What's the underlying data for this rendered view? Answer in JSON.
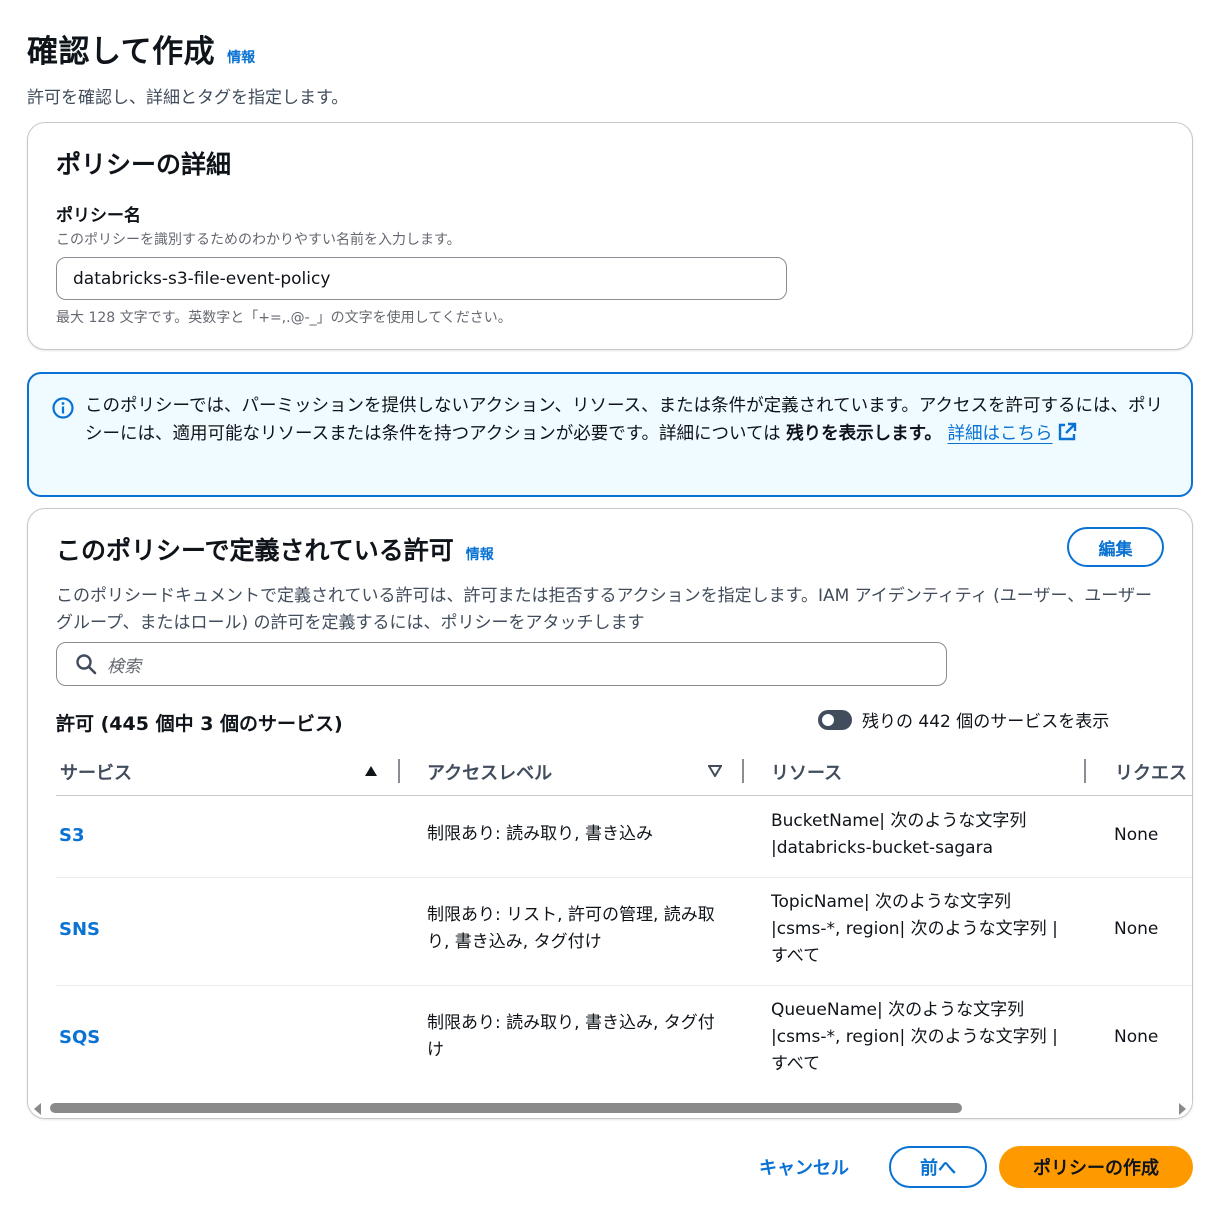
{
  "header": {
    "title": "確認して作成",
    "info_label": "情報",
    "description": "許可を確認し、詳細とタグを指定します。"
  },
  "policy_details": {
    "title": "ポリシーの詳細",
    "name_label": "ポリシー名",
    "name_description": "このポリシーを識別するためのわかりやすい名前を入力します。",
    "name_value": "databricks-s3-file-event-policy",
    "name_constraint": "最大 128 文字です。英数字と「+=,.@-_」の文字を使用してください。"
  },
  "alert": {
    "text_part1": "このポリシーでは、パーミッションを提供しないアクション、リソース、または条件が定義されています。アクセスを許可するには、ポリシーには、適用可能なリソースまたは条件を持つアクションが必要です。詳細については ",
    "text_bold": "残りを表示します。",
    "link_label": "詳細はこちら"
  },
  "permissions": {
    "title": "このポリシーで定義されている許可",
    "info_label": "情報",
    "edit_label": "編集",
    "description": "このポリシードキュメントで定義されている許可は、許可または拒否するアクションを指定します。IAM アイデンティティ (ユーザー、ユーザーグループ、またはロール) の許可を定義するには、ポリシーをアタッチします",
    "search_placeholder": "検索",
    "count_label": "許可 (445 個中 3 個のサービス)",
    "toggle_label": "残りの 442 個のサービスを表示",
    "columns": {
      "service": "サービス",
      "access_level": "アクセスレベル",
      "resource": "リソース",
      "request": "リクエス"
    },
    "rows": [
      {
        "service": "S3",
        "access_level": "制限あり: 読み取り, 書き込み",
        "resource": "BucketName| 次のような文字列 |databricks-bucket-sagara",
        "request": "None"
      },
      {
        "service": "SNS",
        "access_level": "制限あり: リスト, 許可の管理, 読み取り, 書き込み, タグ付け",
        "resource": "TopicName| 次のような文字列 |csms-*, region| 次のような文字列 |すべて",
        "request": "None"
      },
      {
        "service": "SQS",
        "access_level": "制限あり: 読み取り, 書き込み, タグ付け",
        "resource": "QueueName| 次のような文字列 |csms-*, region| 次のような文字列 |すべて",
        "request": "None"
      }
    ]
  },
  "footer": {
    "cancel_label": "キャンセル",
    "previous_label": "前へ",
    "create_label": "ポリシーの作成"
  },
  "colors": {
    "accent": "#0972d3",
    "primary_button": "#ff9900",
    "alert_bg": "#f0fbff"
  }
}
